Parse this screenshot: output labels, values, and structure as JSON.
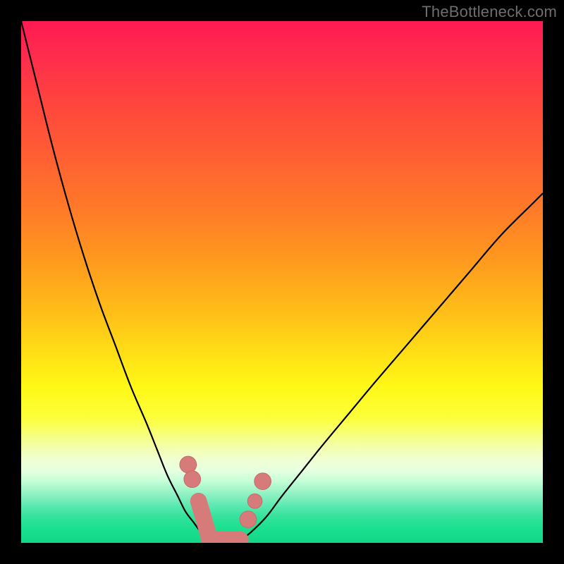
{
  "watermark": "TheBottleneck.com",
  "colors": {
    "frame": "#000000",
    "curve_stroke": "#000000",
    "marker_fill": "#d77a7a",
    "marker_stroke": "#c86a6a"
  },
  "chart_data": {
    "type": "line",
    "title": "",
    "xlabel": "",
    "ylabel": "",
    "xlim": [
      0,
      100
    ],
    "ylim": [
      0,
      100
    ],
    "grid": false,
    "legend": false,
    "series": [
      {
        "name": "left-curve",
        "x": [
          0,
          3,
          6,
          9,
          12,
          15,
          18,
          21,
          24,
          26,
          28,
          30,
          31.5,
          33,
          34.5,
          36
        ],
        "y": [
          100,
          88,
          76,
          65,
          55,
          46,
          38,
          30,
          23,
          18,
          13,
          9,
          6,
          4,
          2,
          0.5
        ]
      },
      {
        "name": "floor",
        "x": [
          36,
          38,
          40,
          42
        ],
        "y": [
          0.5,
          0.2,
          0.2,
          0.5
        ]
      },
      {
        "name": "right-curve",
        "x": [
          42,
          44,
          47,
          50,
          54,
          58,
          63,
          68,
          74,
          80,
          86,
          92,
          98,
          100
        ],
        "y": [
          0.5,
          2,
          5,
          9,
          14,
          19,
          25,
          31,
          38,
          45,
          52,
          59,
          65,
          67
        ]
      }
    ],
    "markers": [
      {
        "shape": "circle",
        "cx": 32.0,
        "cy": 15.0,
        "r": 1.6
      },
      {
        "shape": "circle",
        "cx": 32.8,
        "cy": 12.2,
        "r": 1.6
      },
      {
        "shape": "capsule",
        "x1": 34.0,
        "y1": 8.0,
        "x2": 36.0,
        "y2": 1.2,
        "r": 1.6
      },
      {
        "shape": "capsule",
        "x1": 36.0,
        "y1": 0.6,
        "x2": 42.0,
        "y2": 0.6,
        "r": 1.6
      },
      {
        "shape": "circle",
        "cx": 43.5,
        "cy": 4.5,
        "r": 1.6
      },
      {
        "shape": "circle",
        "cx": 44.8,
        "cy": 8.0,
        "r": 1.4
      },
      {
        "shape": "circle",
        "cx": 46.3,
        "cy": 11.8,
        "r": 1.6
      }
    ]
  }
}
